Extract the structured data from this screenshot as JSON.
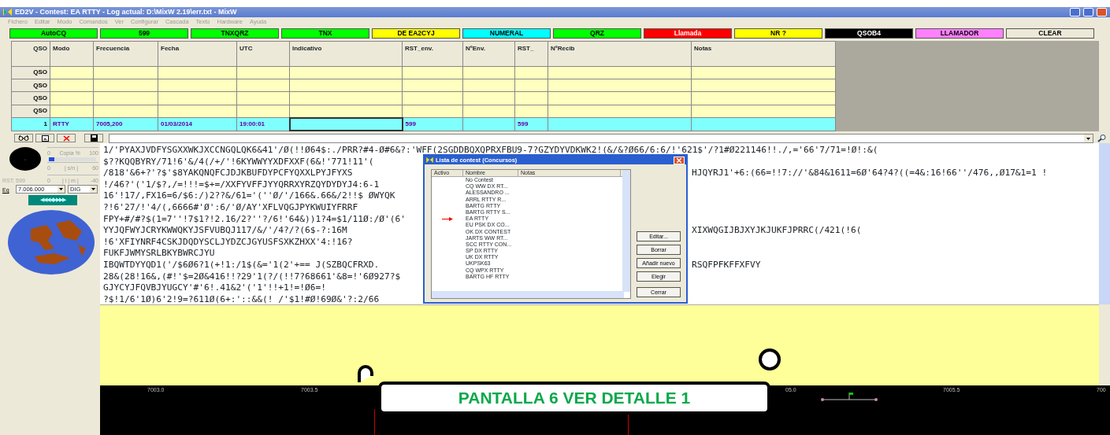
{
  "window": {
    "title": "ED2V - Contest: EA RTTY - Log actual: D:\\MixW 2.19\\err.txt - MixW"
  },
  "menu": [
    "Fichero",
    "Editar",
    "Modo",
    "Comandos",
    "Ver",
    "Configurar",
    "Cascada",
    "Texto",
    "Hardware",
    "Ayuda"
  ],
  "macros": [
    {
      "label": "AutoCQ",
      "color": "#00ff00"
    },
    {
      "label": "599",
      "color": "#00ff00"
    },
    {
      "label": "TNXQRZ",
      "color": "#00ff00"
    },
    {
      "label": "TNX",
      "color": "#00ff00"
    },
    {
      "label": "DE EA2CYJ",
      "color": "#ffff00"
    },
    {
      "label": "NUMERAL",
      "color": "#00ffff"
    },
    {
      "label": "QRZ",
      "color": "#00ff00"
    },
    {
      "label": "Llamada",
      "color": "#ff0000"
    },
    {
      "label": "NR ?",
      "color": "#ffff00"
    },
    {
      "label": "QSOB4",
      "color": "#000000"
    },
    {
      "label": "LLAMADOR",
      "color": "#ff80ff"
    },
    {
      "label": "CLEAR",
      "color": "#ece9d8"
    }
  ],
  "log": {
    "columns": [
      "QSO",
      "Modo",
      "Frecuencia",
      "Fecha",
      "UTC",
      "Indicativo",
      "RST_env.",
      "NºEnv.",
      "RST_",
      "NºRecib",
      "Notas"
    ],
    "rows": [
      {
        "cells": [
          "QSO",
          null,
          null,
          null,
          null,
          null,
          null,
          null,
          null,
          null,
          null
        ],
        "current": false
      },
      {
        "cells": [
          "QSO",
          null,
          null,
          null,
          null,
          null,
          null,
          null,
          null,
          null,
          null
        ],
        "current": false
      },
      {
        "cells": [
          "QSO",
          null,
          null,
          null,
          null,
          null,
          null,
          null,
          null,
          null,
          null
        ],
        "current": false
      },
      {
        "cells": [
          "QSO",
          null,
          null,
          null,
          null,
          null,
          null,
          null,
          null,
          null,
          null
        ],
        "current": false
      },
      {
        "cells": [
          "1",
          "RTTY",
          "7005,200",
          "01/03/2014",
          "19:00:01",
          null,
          "599",
          null,
          "599",
          null,
          null
        ],
        "current": true
      }
    ]
  },
  "tuning": {
    "copy_scale": [
      "0",
      "Copia %",
      "100"
    ],
    "snr_meter": {
      "level": 0.12
    },
    "snr_scale": [
      "0",
      "| s/n |",
      "60"
    ],
    "rst": "RST: 599",
    "imd_scale": [
      "0",
      "| i | m |",
      "-40"
    ],
    "eq_label": "Eq",
    "frequency": "7.006.000",
    "mode": "DIG",
    "arrows": "◀◀◀◀▶▶▶▶"
  },
  "receive_text": [
    {
      "left": "1/'PYAXJVDFYSGXXWKJXCCNGQLQK6&41'/Ø(!!Ø64$:./PRR?#4-Ø#6&?:'WFF(2SGDDBQXQPRXFBU9-7?GZYDYVDKWK2!(&/&?Ø66/6:6/!'621$'/?1#Ø221146!!./,='66'7/71=!Ø!:&("
    },
    {
      "left": "$??KQQBYRY/71!6'&/4(/+/'!6KYWWYYXDFXXF(6&!'771!11'("
    },
    {
      "left": "/818'&6+?'?$'$8YAKQNQFCJDJKBUFDYPCFYQXXLPYJFYXS",
      "right": "HJQYRJ1'+6:(66=!!7://'&84&1611=6Ø'64?4?((=4&:16!66''/476,,Ø17&1=1 !"
    },
    {
      "left": "!/46?'('1/$?,/=!!!=$+=/XXFYVFFJYYQRRXYRZQYDYDYJ4:6-1"
    },
    {
      "left": "16'!17/,FX16=6/$6:/)2??&/61='(''Ø/'/166&.66&/2!!$ ØWYQK"
    },
    {
      "left": "?!6'27/!'4/(,6666#'Ø':6/'Ø/AY'XFLVQGJPYKWUIYFRRF"
    },
    {
      "left": "FPY+#/#?$(1=7''!7$1?!2.16/2?''?/6!'64&))1?4=$1/11Ø:/Ø'(6'"
    },
    {
      "left": "YYJQFWYJCRYKWWQKYJSFVUBQJ117/&/'/4?/?(6$-?:16M",
      "right": "XIXWQGIJBJXYJKJUKFJPRRC(/421(!6("
    },
    {
      "left": "!6'XFIYNRF4CSKJDQDYSCLJYDZCJGYUSFSXKZHXX'4:!16?"
    },
    {
      "left": "FUKFJWMYSRLBKYBWRCJYU"
    },
    {
      "left": "IBQWTDYYQD1('/$6Ø6?1(+!1:/1$(&='1(2'+== J(SZBQCFRXD.",
      "right": "RSQFPFKFFXFVY"
    },
    {
      "left": "28&(28!16&,(#!'$=2Ø&416!!?29'1(?/(!!7?68661'&8=!'6Ø927?$"
    },
    {
      "left": "GJYCYJFQVBJYUGCY'#'6!.41&2'('1'!!+1!=!Ø6=!"
    },
    {
      "left": "?$!1/6'1Ø)6'2!9=?611Ø(6+:'::&&(! /'$1!#Ø!69Ø&'?:2/66"
    }
  ],
  "contest_dialog": {
    "title": "Lista de contest (Concursos)",
    "columns": [
      "Activo",
      "Nombre",
      "Notas"
    ],
    "items": [
      {
        "name": "No Contest",
        "selected": false
      },
      {
        "name": "CQ WW  DX RT...",
        "selected": false
      },
      {
        "name": "ALESSANDRO ...",
        "selected": false
      },
      {
        "name": "ARRL RTTY R...",
        "selected": false
      },
      {
        "name": "BARTG RTTY",
        "selected": false
      },
      {
        "name": "BARTG RTTY S...",
        "selected": false
      },
      {
        "name": "EA RTTY",
        "selected": true
      },
      {
        "name": "EU PSK DX CO...",
        "selected": false
      },
      {
        "name": "OK DX CONTEST",
        "selected": false
      },
      {
        "name": "JARTS WW RT...",
        "selected": false
      },
      {
        "name": "SCC RTTY CON...",
        "selected": false
      },
      {
        "name": "SP DX RTTY",
        "selected": false
      },
      {
        "name": "UK DX RTTY",
        "selected": false
      },
      {
        "name": "UKPSK63",
        "selected": false
      },
      {
        "name": "CQ WPX RTTY",
        "selected": false
      },
      {
        "name": "BARTG HF RTTY",
        "selected": false
      }
    ],
    "buttons": [
      "Editar...",
      "Borrar",
      "Añadir nuevo",
      "Elegir"
    ],
    "close_button": "Cerrar"
  },
  "waterfall": {
    "scale": [
      "7003.0",
      "7003.5",
      "05.0",
      "7005.5",
      "700"
    ]
  },
  "banner": {
    "text": "PANTALLA 6 VER DETALLE 1"
  }
}
